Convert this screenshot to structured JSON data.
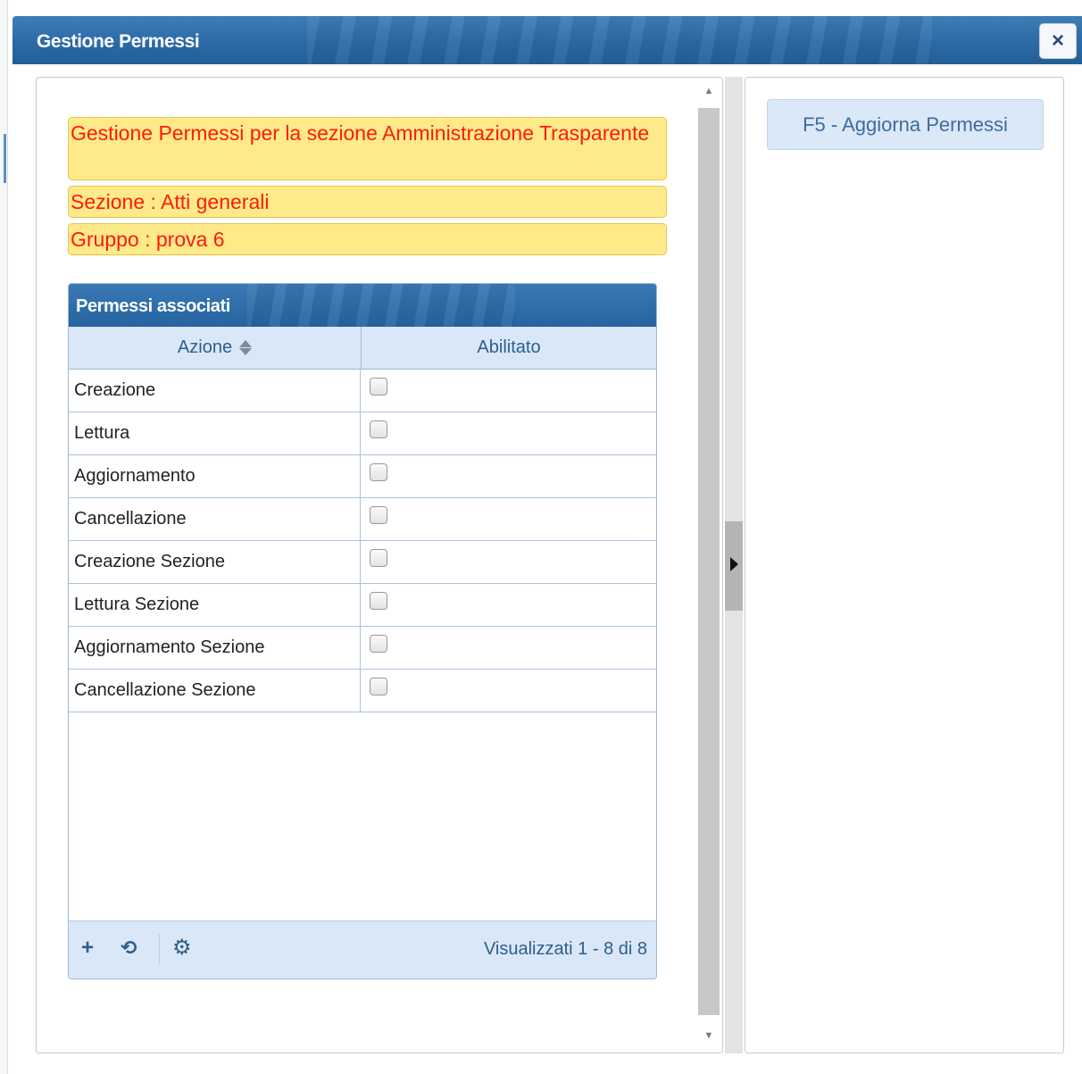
{
  "window": {
    "title": "Gestione Permessi",
    "close_icon": "×"
  },
  "info": {
    "line1": "Gestione Permessi per la sezione Amministrazione Trasparente",
    "line2": "Sezione : Atti generali",
    "line3": "Gruppo : prova 6"
  },
  "grid": {
    "caption": "Permessi associati",
    "columns": [
      "Azione",
      "Abilitato"
    ],
    "rows": [
      {
        "azione": "Creazione",
        "abilitato": false
      },
      {
        "azione": "Lettura",
        "abilitato": false
      },
      {
        "azione": "Aggiornamento",
        "abilitato": false
      },
      {
        "azione": "Cancellazione",
        "abilitato": false
      },
      {
        "azione": "Creazione Sezione",
        "abilitato": false
      },
      {
        "azione": "Lettura Sezione",
        "abilitato": false
      },
      {
        "azione": "Aggiornamento Sezione",
        "abilitato": false
      },
      {
        "azione": "Cancellazione Sezione",
        "abilitato": false
      }
    ],
    "footer": {
      "add_icon": "+",
      "refresh_icon": "⟲",
      "settings_icon": "⚙",
      "record_info": "Visualizzati 1 - 8 di 8"
    }
  },
  "side": {
    "refresh_button": "F5 - Aggiorna Permessi"
  }
}
